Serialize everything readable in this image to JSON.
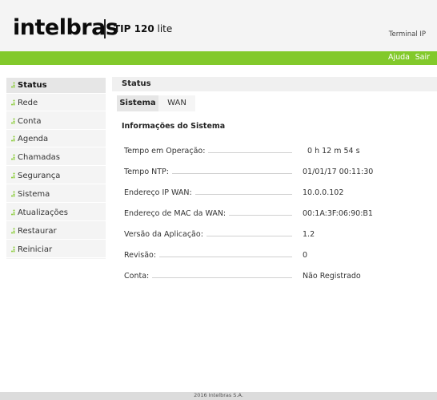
{
  "header": {
    "logo_text": "intelbras",
    "model_bold": "TIP 120",
    "model_suffix": "lite",
    "terminal_label": "Terminal IP"
  },
  "topbar": {
    "help_label": "Ajuda",
    "logout_label": "Sair",
    "accent_color": "#82c92b"
  },
  "sidebar": {
    "items": [
      {
        "label": "Status",
        "active": true
      },
      {
        "label": "Rede"
      },
      {
        "label": "Conta"
      },
      {
        "label": "Agenda"
      },
      {
        "label": "Chamadas"
      },
      {
        "label": "Segurança"
      },
      {
        "label": "Sistema"
      },
      {
        "label": "Atualizações"
      },
      {
        "label": "Restaurar"
      },
      {
        "label": "Reiniciar"
      }
    ]
  },
  "main": {
    "title": "Status",
    "tabs": [
      {
        "label": "Sistema",
        "active": true
      },
      {
        "label": "WAN"
      }
    ],
    "section_title": "Informações do Sistema",
    "rows": [
      {
        "label": "Tempo em Operação:",
        "value": "0 h 12 m 54 s"
      },
      {
        "label": "Tempo NTP:",
        "value": "01/01/17 00:11:30"
      },
      {
        "label": "Endereço IP WAN:",
        "value": "10.0.0.102"
      },
      {
        "label": "Endereço de MAC da WAN:",
        "value": "00:1A:3F:06:90:B1"
      },
      {
        "label": "Versão da Aplicação:",
        "value": "1.2"
      },
      {
        "label": "Revisão:",
        "value": "0"
      },
      {
        "label": "Conta:",
        "value": "Não Registrado"
      }
    ]
  },
  "footer": {
    "text": "2016 Intelbras S.A."
  }
}
